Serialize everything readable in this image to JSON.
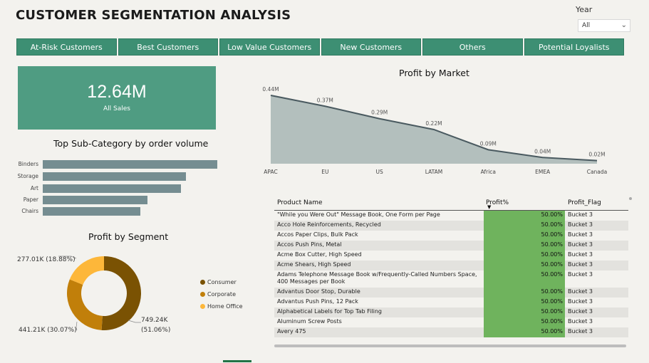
{
  "header": {
    "title": "CUSTOMER SEGMENTATION ANALYSIS"
  },
  "filter": {
    "label": "Year",
    "value": "All",
    "chevron_icon": "chevron-down-icon"
  },
  "segments": [
    "At-Risk Customers",
    "Best Customers",
    "Low Value Customers",
    "New Customers",
    "Others",
    "Potential Loyalists"
  ],
  "kpi": {
    "value": "12.64M",
    "label": "All Sales"
  },
  "subcategory": {
    "title": "Top Sub-Category by order volume",
    "bars": [
      {
        "label": "Binders",
        "value": 1.0
      },
      {
        "label": "Storage",
        "value": 0.82
      },
      {
        "label": "Art",
        "value": 0.79
      },
      {
        "label": "Paper",
        "value": 0.6
      },
      {
        "label": "Chairs",
        "value": 0.56
      }
    ]
  },
  "segment_chart": {
    "title": "Profit by Segment",
    "legend": [
      {
        "name": "Consumer",
        "color": "#7a5203"
      },
      {
        "name": "Corporate",
        "color": "#c17f0a"
      },
      {
        "name": "Home Office",
        "color": "#fdb73a"
      }
    ],
    "labels": {
      "consumer": "749.24K",
      "consumer_pct": "(51.06%)",
      "corporate": "441.21K (30.07%)",
      "home": "277.01K (18.88%)"
    }
  },
  "market_chart": {
    "title": "Profit by Market"
  },
  "chart_data": [
    {
      "type": "area",
      "title": "Profit by Market",
      "categories": [
        "APAC",
        "EU",
        "US",
        "LATAM",
        "Africa",
        "EMEA",
        "Canada"
      ],
      "values": [
        0.44,
        0.37,
        0.29,
        0.22,
        0.09,
        0.04,
        0.02
      ],
      "data_labels": [
        "0.44M",
        "0.37M",
        "0.29M",
        "0.22M",
        "0.09M",
        "0.04M",
        "0.02M"
      ],
      "ylim": [
        0,
        0.44
      ],
      "colors": {
        "line": "#4a5a60",
        "fill": "#b3bfbd"
      }
    },
    {
      "type": "pie",
      "title": "Profit by Segment",
      "categories": [
        "Consumer",
        "Corporate",
        "Home Office"
      ],
      "values": [
        749.24,
        441.21,
        277.01
      ],
      "percents": [
        51.06,
        30.07,
        18.88
      ]
    },
    {
      "type": "bar",
      "title": "Top Sub-Category by order volume",
      "categories": [
        "Binders",
        "Storage",
        "Art",
        "Paper",
        "Chairs"
      ],
      "values": [
        1.0,
        0.82,
        0.79,
        0.6,
        0.56
      ]
    }
  ],
  "table": {
    "columns": [
      "Product Name",
      "Profit%",
      "Profit_Flag"
    ],
    "sort_icon": "sort-down-icon",
    "rows": [
      {
        "name": "\"While you Were Out\" Message Book, One Form per Page",
        "pct": "50.00%",
        "flag": "Bucket 3"
      },
      {
        "name": "Acco Hole Reinforcements, Recycled",
        "pct": "50.00%",
        "flag": "Bucket 3"
      },
      {
        "name": "Accos Paper Clips, Bulk Pack",
        "pct": "50.00%",
        "flag": "Bucket 3"
      },
      {
        "name": "Accos Push Pins, Metal",
        "pct": "50.00%",
        "flag": "Bucket 3"
      },
      {
        "name": "Acme Box Cutter, High Speed",
        "pct": "50.00%",
        "flag": "Bucket 3"
      },
      {
        "name": "Acme Shears, High Speed",
        "pct": "50.00%",
        "flag": "Bucket 3"
      },
      {
        "name": "Adams Telephone Message Book w/Frequently-Called Numbers Space, 400 Messages per Book",
        "pct": "50.00%",
        "flag": "Bucket 3",
        "tall": true
      },
      {
        "name": "Advantus Door Stop, Durable",
        "pct": "50.00%",
        "flag": "Bucket 3"
      },
      {
        "name": "Advantus Push Pins, 12 Pack",
        "pct": "50.00%",
        "flag": "Bucket 3"
      },
      {
        "name": "Alphabetical Labels for Top Tab Filing",
        "pct": "50.00%",
        "flag": "Bucket 3"
      },
      {
        "name": "Aluminum Screw Posts",
        "pct": "50.00%",
        "flag": "Bucket 3"
      },
      {
        "name": "Avery 475",
        "pct": "50.00%",
        "flag": "Bucket 3"
      }
    ]
  }
}
